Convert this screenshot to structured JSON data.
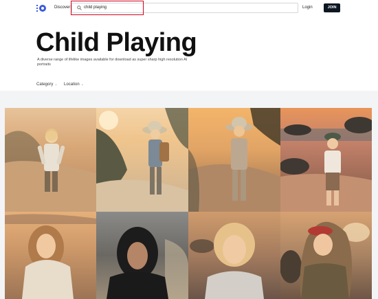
{
  "header": {
    "discover_label": "Discover",
    "search_value": "child playing",
    "login_label": "Login",
    "join_label": "JOIN"
  },
  "page": {
    "title": "Child Playing",
    "subtitle": "A diverse range of lifelike images available for download as super sharp high resolution AI portraits"
  },
  "filters": {
    "category_label": "Category",
    "location_label": "Location"
  },
  "colors": {
    "join_bg": "#0d1722",
    "search_highlight": "#d0021b",
    "logo_blue": "#3b5bdb",
    "band_bg": "#f3f4f6"
  },
  "gallery": [
    {
      "subject": "child in white shirt walking on beach dunes at sunset"
    },
    {
      "subject": "child with hat and backpack walking on sand dunes"
    },
    {
      "subject": "child with hat standing on dunes in golden light"
    },
    {
      "subject": "child with hat standing on rocky beach at sunset"
    },
    {
      "subject": "girl with long hair on beach at sunset"
    },
    {
      "subject": "child in dark hooded jacket portrait"
    },
    {
      "subject": "blonde girl portrait at sunset"
    },
    {
      "subject": "child with red cap and hooded jacket on beach"
    }
  ]
}
